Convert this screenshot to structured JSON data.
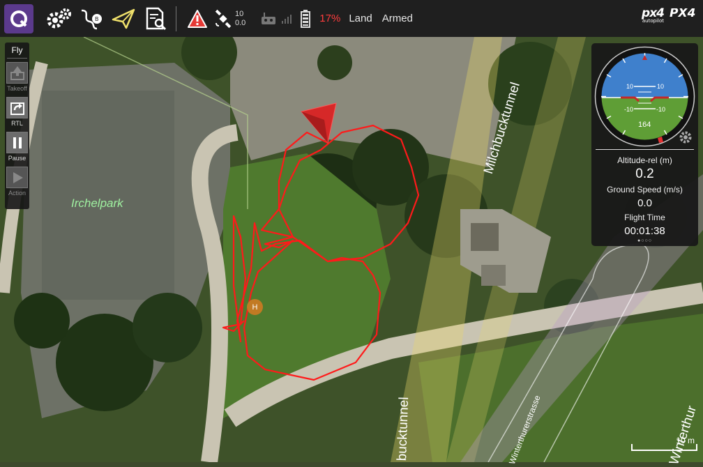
{
  "toolbar": {
    "gps_count": "10",
    "hdop": "0.0",
    "battery_percent": "17%",
    "flight_mode": "Land",
    "armed_status": "Armed",
    "icons": [
      "qgc-logo-icon",
      "settings-gears-icon",
      "plan-route-icon",
      "fly-plane-icon",
      "analyze-document-icon",
      "warning-icon",
      "gps-satellite-icon",
      "rc-transmitter-icon",
      "telemetry-signal-icon",
      "battery-icon"
    ],
    "colors": {
      "warning": "#e53935",
      "battery_low": "#ff3d3d",
      "fly_active": "#f0e16b"
    }
  },
  "brand": {
    "logo_main": "px4",
    "logo_sub": "autopilot",
    "logo_partial": "PX4"
  },
  "fly_panel": {
    "title": "Fly",
    "buttons": [
      {
        "label": "Takeoff",
        "icon": "takeoff-icon",
        "enabled": false
      },
      {
        "label": "RTL",
        "icon": "rtl-icon",
        "enabled": true
      },
      {
        "label": "Pause",
        "icon": "pause-icon",
        "enabled": true
      },
      {
        "label": "Action",
        "icon": "action-play-icon",
        "enabled": false
      }
    ]
  },
  "instrument": {
    "pitch_up": "10",
    "pitch_down": "-10",
    "heading": "164",
    "altitude_label": "Altitude-rel (m)",
    "altitude_value": "0.2",
    "ground_speed_label": "Ground Speed (m/s)",
    "ground_speed_value": "0.0",
    "flight_time_label": "Flight Time",
    "flight_time_value": "00:01:38",
    "page_dots": "●○○○",
    "colors": {
      "sky": "#3f80cc",
      "ground": "#5f9e36"
    }
  },
  "map": {
    "labels": {
      "park": "Irchelpark",
      "tunnel_upper": "Milchbucktunnel",
      "tunnel_lower": "bucktunnel",
      "street": "Winterthurerstrasse",
      "street_right": "Winterthur"
    },
    "home_marker": "H",
    "scale_label": "10 m",
    "colors": {
      "track": "#ff1a1a",
      "vehicle": "#e53030",
      "home": "#c27a23"
    }
  }
}
